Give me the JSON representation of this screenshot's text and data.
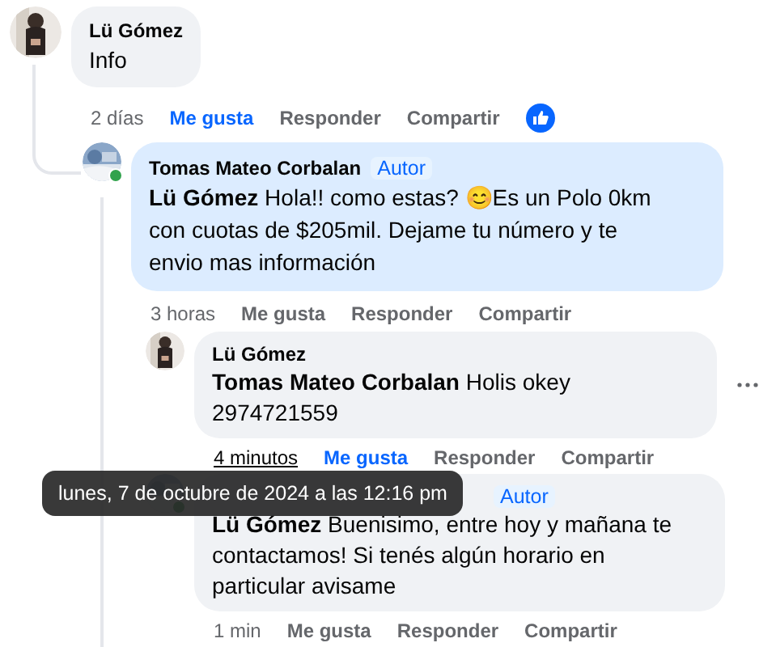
{
  "comments": [
    {
      "author": "Lü Gómez",
      "text": "Info",
      "time": "2 días",
      "time_hovered": false,
      "liked": true,
      "online": false,
      "highlighted": false,
      "has_reaction": true,
      "actions": [
        "Me gusta",
        "Responder",
        "Compartir"
      ],
      "children": [
        {
          "author": "Tomas Mateo Corbalan",
          "badge": "Autor",
          "mention": "Lü Gómez",
          "text": "Hola!! como estas? 😊Es un Polo 0km con cuotas de $205mil. Dejame tu número y te envio mas información",
          "time": "3 horas",
          "time_hovered": false,
          "liked": false,
          "online": true,
          "highlighted": true,
          "has_reaction": false,
          "actions": [
            "Me gusta",
            "Responder",
            "Compartir"
          ],
          "children": [
            {
              "author": "Lü Gómez",
              "mention": "Tomas Mateo Corbalan",
              "text": "Holis okey 2974721559",
              "time": "4 minutos",
              "time_hovered": true,
              "liked": true,
              "online": false,
              "highlighted": false,
              "has_reaction": false,
              "has_more": true,
              "actions": [
                "Me gusta",
                "Responder",
                "Compartir"
              ]
            },
            {
              "badge": "Autor",
              "mention": "Lü Gómez",
              "text": "Buenisimo, entre hoy y mañana te contactamos! Si tenés algún horario en particular avisame",
              "time": "1 min",
              "time_hovered": false,
              "liked": false,
              "online": true,
              "highlighted": false,
              "has_reaction": false,
              "actions": [
                "Me gusta",
                "Responder",
                "Compartir"
              ]
            }
          ]
        }
      ]
    }
  ],
  "tooltip": {
    "text": "lunes, 7 de octubre de 2024 a las 12:16 pm"
  }
}
